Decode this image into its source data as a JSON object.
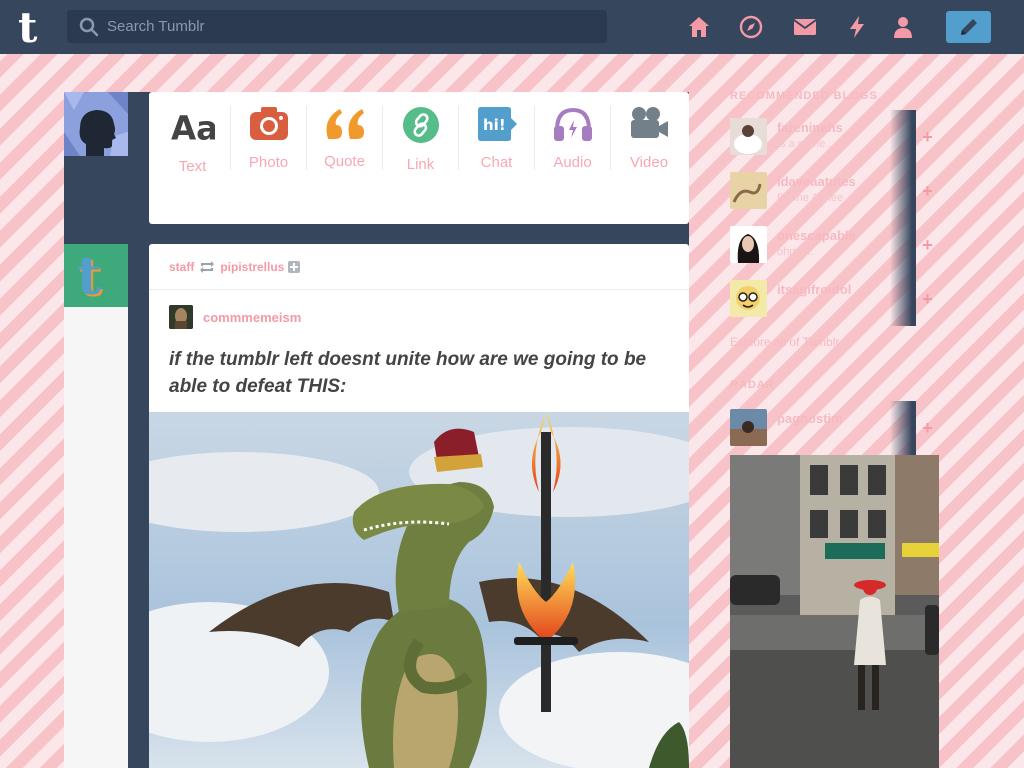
{
  "header": {
    "search_placeholder": "Search Tumblr",
    "nav": [
      "home-icon",
      "explore-icon",
      "inbox-icon",
      "activity-icon",
      "account-icon"
    ],
    "compose_icon": "pencil-icon"
  },
  "post_types": [
    {
      "label": "Text",
      "icon": "text-icon",
      "color": "#444444"
    },
    {
      "label": "Photo",
      "icon": "camera-icon",
      "color": "#d95e40"
    },
    {
      "label": "Quote",
      "icon": "quote-icon",
      "color": "#f2992e"
    },
    {
      "label": "Link",
      "icon": "link-icon",
      "color": "#56bc8a"
    },
    {
      "label": "Chat",
      "icon": "chat-icon",
      "color": "#529ecc"
    },
    {
      "label": "Audio",
      "icon": "headphones-icon",
      "color": "#a77dc2"
    },
    {
      "label": "Video",
      "icon": "video-camera-icon",
      "color": "#748089"
    }
  ],
  "post": {
    "reblogged_by": "staff",
    "reblogged_from": "pipistrellus",
    "author": "commmemeism",
    "text": "if the tumblr left doesnt unite how are we going to be able to defeat THIS:"
  },
  "sidebar": {
    "recommended_heading": "RECOMMENDED BLOGS",
    "recommended": [
      {
        "name": "fareninehs",
        "subtitle": "Is a name..."
      },
      {
        "name": "idaveaatutes",
        "subtitle": "Bonne Annee"
      },
      {
        "name": "onescapable",
        "subtitle": "ohme..."
      },
      {
        "name": "itsagifroidol",
        "subtitle": "..."
      }
    ],
    "explore_label": "Explore all of Tumblr",
    "radar_heading": "RADAR",
    "radar_blog": {
      "name": "pagnostim",
      "subtitle": ""
    }
  },
  "colors": {
    "navy": "#36465d",
    "accent_pink": "#f49aa6",
    "compose_blue": "#529ecc"
  }
}
